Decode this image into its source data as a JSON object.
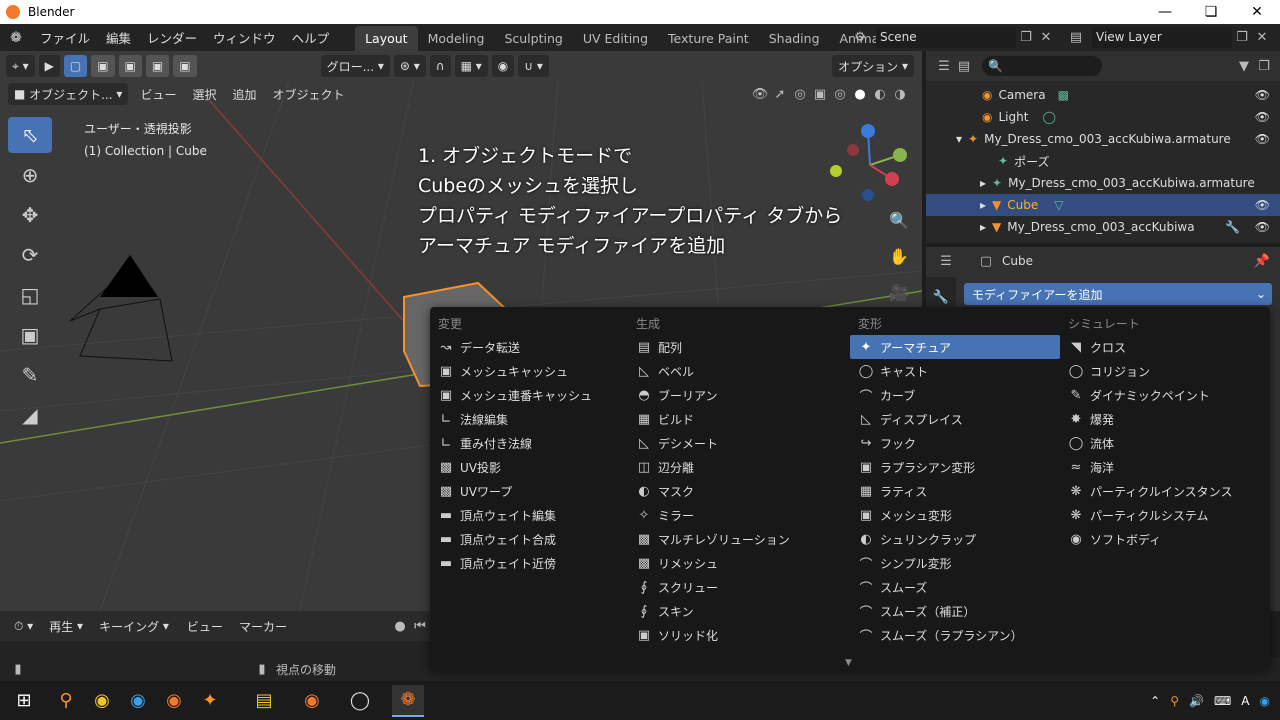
{
  "window": {
    "title": "Blender"
  },
  "menu": {
    "items": [
      "ファイル",
      "編集",
      "レンダー",
      "ウィンドウ",
      "ヘルプ"
    ]
  },
  "workspaces": [
    {
      "label": "Layout",
      "active": true
    },
    {
      "label": "Modeling"
    },
    {
      "label": "Sculpting"
    },
    {
      "label": "UV Editing"
    },
    {
      "label": "Texture Paint"
    },
    {
      "label": "Shading"
    },
    {
      "label": "Animat"
    }
  ],
  "scene": {
    "name": "Scene"
  },
  "view_layer": {
    "name": "View Layer"
  },
  "viewport": {
    "transform_orientation": "グロー...",
    "options_label": "オプション",
    "mode_label": "オブジェクト...",
    "header_menus": [
      "ビュー",
      "選択",
      "追加",
      "オブジェクト"
    ],
    "view_name": "ユーザー・透視投影",
    "collection_info": "(1) Collection | Cube",
    "caption_lines": [
      "1. オブジェクトモードで",
      "Cubeのメッシュを選択し",
      "プロパティ モディファイアープロパティ タブから",
      "アーマチュア モディファイアを追加"
    ]
  },
  "outliner": {
    "rows": [
      {
        "label": "Camera",
        "icon": "camera-icon",
        "indent": 1
      },
      {
        "label": "Light",
        "icon": "light-icon",
        "indent": 1
      },
      {
        "label": "My_Dress_cmo_003_accKubiwa.armature",
        "icon": "armature-icon",
        "indent": 0
      },
      {
        "label": "ポーズ",
        "icon": "pose-icon",
        "indent": 1
      },
      {
        "label": "My_Dress_cmo_003_accKubiwa.armature",
        "icon": "armature-data-icon",
        "indent": 1
      },
      {
        "label": "Cube",
        "icon": "mesh-icon",
        "indent": 1,
        "selected": true
      },
      {
        "label": "My_Dress_cmo_003_accKubiwa",
        "icon": "mesh-icon",
        "indent": 1
      }
    ]
  },
  "properties": {
    "object_name": "Cube",
    "add_modifier_label": "モディファイアーを追加"
  },
  "modifier_menu": {
    "columns": [
      {
        "title": "変更",
        "items": [
          "データ転送",
          "メッシュキャッシュ",
          "メッシュ連番キャッシュ",
          "法線編集",
          "重み付き法線",
          "UV投影",
          "UVワープ",
          "頂点ウェイト編集",
          "頂点ウェイト合成",
          "頂点ウェイト近傍"
        ]
      },
      {
        "title": "生成",
        "items": [
          "配列",
          "ベベル",
          "ブーリアン",
          "ビルド",
          "デシメート",
          "辺分離",
          "マスク",
          "ミラー",
          "マルチレゾリューション",
          "リメッシュ",
          "スクリュー",
          "スキン",
          "ソリッド化"
        ]
      },
      {
        "title": "変形",
        "items": [
          "アーマチュア",
          "キャスト",
          "カーブ",
          "ディスプレイス",
          "フック",
          "ラプラシアン変形",
          "ラティス",
          "メッシュ変形",
          "シュリンクラップ",
          "シンプル変形",
          "スムーズ",
          "スムーズ（補正）",
          "スムーズ（ラプラシアン）"
        ]
      },
      {
        "title": "シミュレート",
        "items": [
          "クロス",
          "コリジョン",
          "ダイナミックペイント",
          "爆発",
          "流体",
          "海洋",
          "パーティクルインスタンス",
          "パーティクルシステム",
          "ソフトボディ"
        ]
      }
    ],
    "highlighted": "アーマチュア"
  },
  "timeline": {
    "menus": [
      "再生",
      "キーイング",
      "ビュー",
      "マーカー"
    ]
  },
  "statusbar": {
    "hint": "視点の移動"
  },
  "colors": {
    "accent": "#4772b3",
    "selected_text": "#ffaf29",
    "orange": "#f5792a"
  }
}
